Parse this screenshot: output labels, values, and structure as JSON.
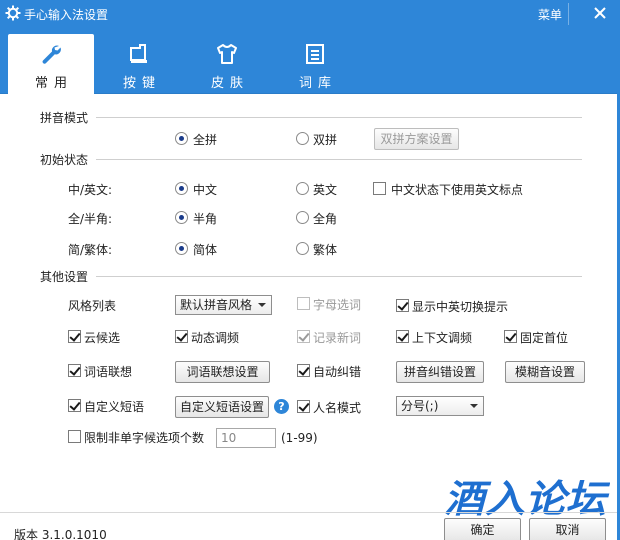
{
  "window": {
    "title": "手心输入法设置",
    "menu_label": "菜单"
  },
  "tabs": [
    {
      "label": "常用",
      "icon": "wrench-icon",
      "active": true
    },
    {
      "label": "按键",
      "icon": "keyboard-icon",
      "active": false
    },
    {
      "label": "皮肤",
      "icon": "tshirt-icon",
      "active": false
    },
    {
      "label": "词库",
      "icon": "list-icon",
      "active": false
    }
  ],
  "pinyin_mode": {
    "title": "拼音模式",
    "full_label": "全拼",
    "double_label": "双拼",
    "double_scheme_button": "双拼方案设置",
    "selected": "全拼"
  },
  "initial_state": {
    "title": "初始状态",
    "rows": [
      {
        "label": "中/英文:",
        "opt1": "中文",
        "opt2": "英文",
        "selected": "中文"
      },
      {
        "label": "全/半角:",
        "opt1": "半角",
        "opt2": "全角",
        "selected": "半角"
      },
      {
        "label": "简/繁体:",
        "opt1": "简体",
        "opt2": "繁体",
        "selected": "简体"
      }
    ],
    "use_english_punct": {
      "label": "中文状态下使用英文标点",
      "checked": false
    }
  },
  "other_settings": {
    "title": "其他设置",
    "style_label": "风格列表",
    "style_value": "默认拼音风格",
    "letter_select": {
      "label": "字母选词",
      "checked": false,
      "disabled": true
    },
    "show_switch_hint": {
      "label": "显示中英切换提示",
      "checked": true
    },
    "cloud_candidate": {
      "label": "云候选",
      "checked": true
    },
    "dynamic_freq": {
      "label": "动态调频",
      "checked": true
    },
    "record_new_words": {
      "label": "记录新词",
      "checked": true,
      "disabled": true
    },
    "context_freq": {
      "label": "上下文调频",
      "checked": true
    },
    "fix_first": {
      "label": "固定首位",
      "checked": true
    },
    "word_association": {
      "label": "词语联想",
      "checked": true
    },
    "word_association_button": "词语联想设置",
    "auto_correct": {
      "label": "自动纠错",
      "checked": true
    },
    "pinyin_correct_button": "拼音纠错设置",
    "fuzzy_button": "模糊音设置",
    "custom_phrase": {
      "label": "自定义短语",
      "checked": true
    },
    "custom_phrase_button": "自定义短语设置",
    "help_glyph": "?",
    "name_mode": {
      "label": "人名模式",
      "checked": true
    },
    "name_mode_value": "分号(;)",
    "limit_candidates": {
      "label": "限制非单字候选项个数",
      "checked": false
    },
    "limit_value": "10",
    "limit_range": "(1-99)"
  },
  "footer": {
    "version": "版本 3.1.0.1010",
    "ok_label": "确定",
    "cancel_label": "取消"
  },
  "watermark": "酒入论坛",
  "colors": {
    "accent": "#2e86d8",
    "watermark": "#1e6fd0"
  }
}
